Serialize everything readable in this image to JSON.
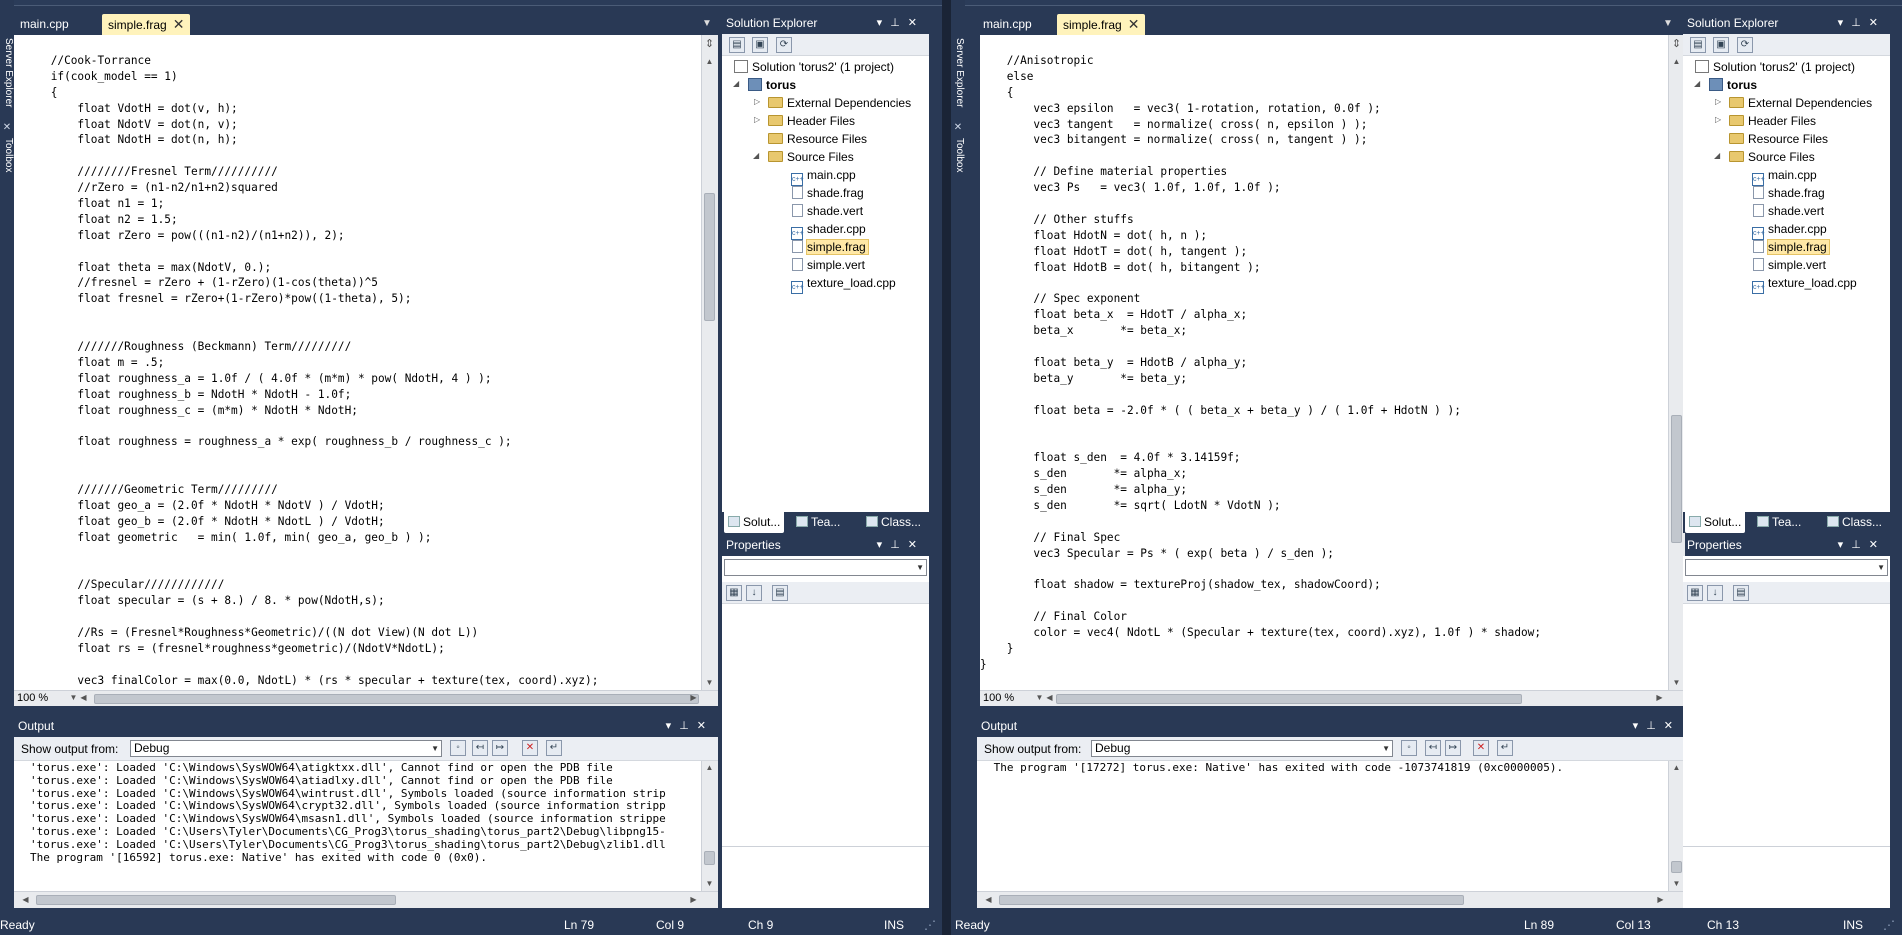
{
  "left": {
    "tabs": [
      {
        "label": "main.cpp"
      },
      {
        "label": "simple.frag",
        "close": "✕"
      }
    ],
    "code": [
      "    //Cook-Torrance",
      "    if(cook_model == 1)",
      "    {",
      "        float VdotH = dot(v, h);",
      "        float NdotV = dot(n, v);",
      "        float NdotH = dot(n, h);",
      "",
      "        ////////Fresnel Term//////////",
      "        //rZero = (n1-n2/n1+n2)squared",
      "        float n1 = 1;",
      "        float n2 = 1.5;",
      "        float rZero = pow(((n1-n2)/(n1+n2)), 2);",
      "",
      "        float theta = max(NdotV, 0.);",
      "        //fresnel = rZero + (1-rZero)(1-cos(theta))^5",
      "        float fresnel = rZero+(1-rZero)*pow((1-theta), 5);",
      "",
      "",
      "        ///////Roughness (Beckmann) Term/////////",
      "        float m = .5;",
      "        float roughness_a = 1.0f / ( 4.0f * (m*m) * pow( NdotH, 4 ) );",
      "        float roughness_b = NdotH * NdotH - 1.0f;",
      "        float roughness_c = (m*m) * NdotH * NdotH;",
      "",
      "        float roughness = roughness_a * exp( roughness_b / roughness_c );",
      "",
      "",
      "        ///////Geometric Term/////////",
      "        float geo_a = (2.0f * NdotH * NdotV ) / VdotH;",
      "        float geo_b = (2.0f * NdotH * NdotL ) / VdotH;",
      "        float geometric   = min( 1.0f, min( geo_a, geo_b ) );",
      "",
      "",
      "        //Specular////////////",
      "        float specular = (s + 8.) / 8. * pow(NdotH,s);",
      "",
      "        //Rs = (Fresnel*Roughness*Geometric)/((N dot View)(N dot L))",
      "        float rs = (fresnel*roughness*geometric)/(NdotV*NdotL);",
      "",
      "        vec3 finalColor = max(0.0, NdotL) * (rs * specular + texture(tex, coord).xyz);"
    ],
    "zoom": "100 %",
    "output": {
      "title": "Output",
      "show_from_label": "Show output from:",
      "source": "Debug",
      "lines": [
        "'torus.exe': Loaded 'C:\\Windows\\SysWOW64\\atigktxx.dll', Cannot find or open the PDB file",
        "'torus.exe': Loaded 'C:\\Windows\\SysWOW64\\atiadlxy.dll', Cannot find or open the PDB file",
        "'torus.exe': Loaded 'C:\\Windows\\SysWOW64\\wintrust.dll', Symbols loaded (source information strip",
        "'torus.exe': Loaded 'C:\\Windows\\SysWOW64\\crypt32.dll', Symbols loaded (source information stripp",
        "'torus.exe': Loaded 'C:\\Windows\\SysWOW64\\msasn1.dll', Symbols loaded (source information strippe",
        "'torus.exe': Loaded 'C:\\Users\\Tyler\\Documents\\CG_Prog3\\torus_shading\\torus_part2\\Debug\\libpng15-",
        "'torus.exe': Loaded 'C:\\Users\\Tyler\\Documents\\CG_Prog3\\torus_shading\\torus_part2\\Debug\\zlib1.dll",
        "The program '[16592] torus.exe: Native' has exited with code 0 (0x0)."
      ]
    },
    "status": {
      "ready": "Ready",
      "ln": "Ln 79",
      "col": "Col 9",
      "ch": "Ch 9",
      "ins": "INS"
    }
  },
  "right": {
    "tabs": [
      {
        "label": "main.cpp"
      },
      {
        "label": "simple.frag",
        "close": "✕"
      }
    ],
    "code": [
      "    //Anisotropic",
      "    else",
      "    {",
      "        vec3 epsilon   = vec3( 1-rotation, rotation, 0.0f );",
      "        vec3 tangent   = normalize( cross( n, epsilon ) );",
      "        vec3 bitangent = normalize( cross( n, tangent ) );",
      "",
      "        // Define material properties",
      "        vec3 Ps   = vec3( 1.0f, 1.0f, 1.0f );",
      "",
      "        // Other stuffs",
      "        float HdotN = dot( h, n );",
      "        float HdotT = dot( h, tangent );",
      "        float HdotB = dot( h, bitangent );",
      "",
      "        // Spec exponent",
      "        float beta_x  = HdotT / alpha_x;",
      "        beta_x       *= beta_x;",
      "",
      "        float beta_y  = HdotB / alpha_y;",
      "        beta_y       *= beta_y;",
      "",
      "        float beta = -2.0f * ( ( beta_x + beta_y ) / ( 1.0f + HdotN ) );",
      "",
      "",
      "        float s_den  = 4.0f * 3.14159f;",
      "        s_den       *= alpha_x;",
      "        s_den       *= alpha_y;",
      "        s_den       *= sqrt( LdotN * VdotN );",
      "",
      "        // Final Spec",
      "        vec3 Specular = Ps * ( exp( beta ) / s_den );",
      "",
      "        float shadow = textureProj(shadow_tex, shadowCoord);",
      "",
      "        // Final Color",
      "        color = vec4( NdotL * (Specular + texture(tex, coord).xyz), 1.0f ) * shadow;",
      "    }",
      "}"
    ],
    "zoom": "100 %",
    "output": {
      "title": "Output",
      "show_from_label": "Show output from:",
      "source": "Debug",
      "lines": [
        " The program '[17272] torus.exe: Native' has exited with code -1073741819 (0xc0000005)."
      ]
    },
    "status": {
      "ready": "Ready",
      "ln": "Ln 89",
      "col": "Col 13",
      "ch": "Ch 13",
      "ins": "INS"
    }
  },
  "solution_explorer": {
    "title": "Solution Explorer",
    "solution": "Solution 'torus2' (1 project)",
    "project": "torus",
    "folders": {
      "ext": "External Dependencies",
      "hdr": "Header Files",
      "res": "Resource Files",
      "src": "Source Files"
    },
    "files": [
      "main.cpp",
      "shade.frag",
      "shade.vert",
      "shader.cpp",
      "simple.frag",
      "simple.vert",
      "texture_load.cpp"
    ],
    "bottom_tabs": [
      "Solut...",
      "Tea...",
      "Class..."
    ]
  },
  "properties": {
    "title": "Properties"
  },
  "sidebar": {
    "server_explorer": "Server Explorer",
    "toolbox": "Toolbox"
  },
  "colors": {
    "chrome": "#293955",
    "active_tab": "#fff3bc",
    "selection": "#ffe8a6"
  }
}
